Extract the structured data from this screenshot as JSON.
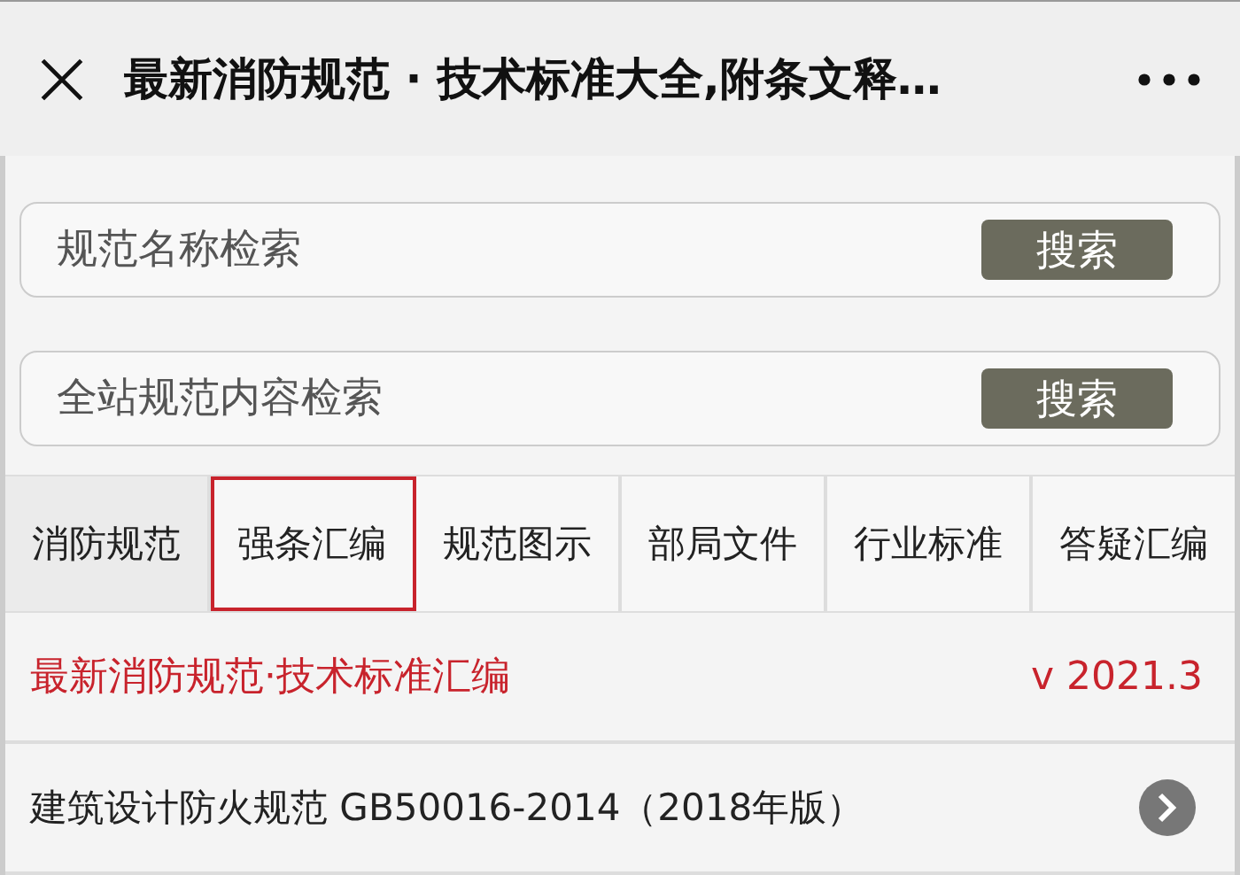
{
  "header": {
    "title": "最新消防规范 · 技术标准大全,附条文释…"
  },
  "searches": [
    {
      "placeholder": "规范名称检索",
      "button": "搜索"
    },
    {
      "placeholder": "全站规范内容检索",
      "button": "搜索"
    }
  ],
  "tabs": [
    {
      "label": "消防规范",
      "selected": false
    },
    {
      "label": "强条汇编",
      "selected": true
    },
    {
      "label": "规范图示",
      "selected": false
    },
    {
      "label": "部局文件",
      "selected": false
    },
    {
      "label": "行业标准",
      "selected": false
    },
    {
      "label": "答疑汇编",
      "selected": false
    }
  ],
  "banner": {
    "title": "最新消防规范·技术标准汇编",
    "version": "v 2021.3"
  },
  "items": [
    {
      "title": "建筑设计防火规范 GB50016-2014（2018年版）"
    }
  ]
}
